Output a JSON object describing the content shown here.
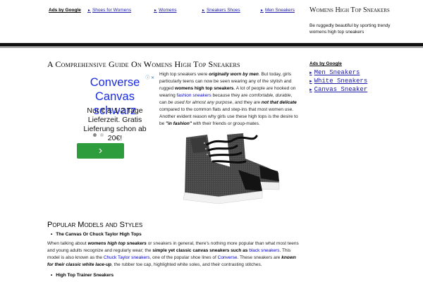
{
  "topbar": {
    "ads_label": "Ads by Google",
    "links": [
      {
        "label": "Shoes for Womens"
      },
      {
        "label": "Womens"
      },
      {
        "label": "Sneakers Shoes"
      },
      {
        "label": "Men Sneakers"
      }
    ],
    "site_title": "Womens High Top Sneakers",
    "site_description": "Be ruggedly beautiful by sporting trendy womens high top sneakers"
  },
  "article": {
    "title": "A Comprehensive Guide On Womens High Top Sneakers",
    "intro": {
      "p1": "High top sneakers were ",
      "p2": "originally worn by men",
      "p3": ". But today, girls particularly teens can now be seen wearing any of the stylish and rugged ",
      "p4": "womens high top sneakers",
      "p5": ". A lot of people are hooked on wearing ",
      "link1": "fashion sneakers",
      "p6": " because they are ",
      "p7": "comfortable, durable",
      "p8": ", can ",
      "p9": "be used for almost any purpose",
      "p10": ", and they are ",
      "p11": "not that delicate",
      "p12": " compared to the common flats and step-ins that most women use. Another evident reason why girls use these high tops is the desire to be ",
      "p13": "\"in fashion\"",
      "p14": " with their friends or group-mates."
    },
    "section_title": "Popular Models and Styles",
    "bullet1": "The Canvas Or Chuck Taylor High Tops",
    "para2": {
      "a1": "When talking about ",
      "a2": "womens high top sneakers",
      "a3": " or sneakers in general, there's nothing more popular than what most teens and young adults recognize and regularly wear; the ",
      "a4": "simple yet classic canvas sneakers such as ",
      "link_black": "black sneakers",
      "a5": ". This model is also known as the ",
      "link_chuck": "Chuck Taylor sneakers",
      "a6": ", one of the popular shoe lines of ",
      "link_converse": "Converse",
      "a7": ". These sneakers are ",
      "a8": "known for their classic white lace-up",
      "a9": ", the rubber toe cap, highlighted white soles, and their contrasting stitches."
    },
    "bullet2": "High Top Trainer Sneakers"
  },
  "ad": {
    "title": "Converse Canvas schwarz",
    "body": "Nur € & 1-2 Tage Lieferzeit. Gratis Lieferung schon ab 20€!",
    "button_glyph": "›",
    "icons": "ⓘ ✕"
  },
  "sidebar": {
    "ads_label": "Ads by Google",
    "links": [
      {
        "label": "Men Sneakers"
      },
      {
        "label": "White Sneakers"
      },
      {
        "label": "Canvas Sneaker"
      }
    ]
  },
  "colors": {
    "link": "#1a1aa6",
    "ad_title": "#1a2ce0",
    "ad_button": "#2c9c3c",
    "rule": "#111111"
  }
}
